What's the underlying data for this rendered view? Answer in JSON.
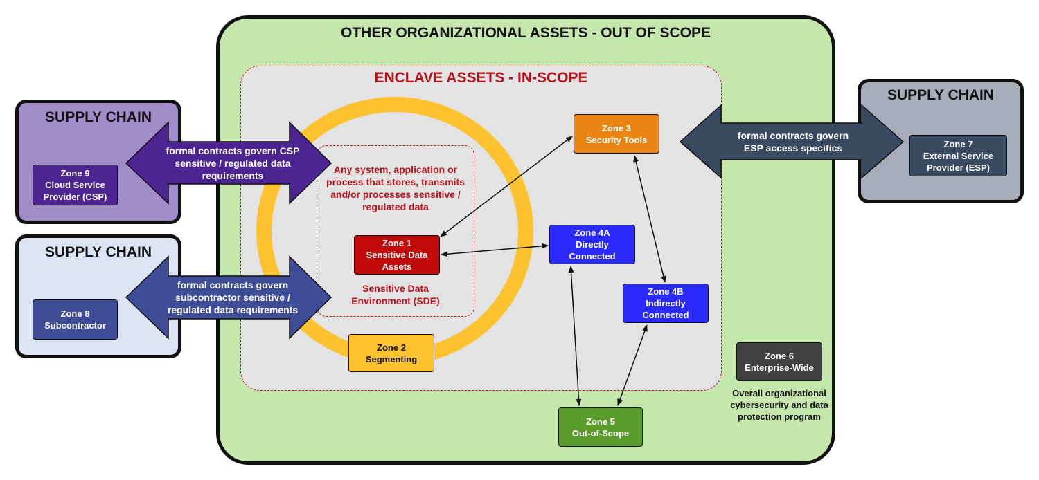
{
  "outer": {
    "title": "OTHER ORGANIZATIONAL ASSETS - OUT OF SCOPE"
  },
  "enclave": {
    "title": "ENCLAVE ASSETS - IN-SCOPE"
  },
  "sde": {
    "description_emphasis": "Any",
    "description_rest": " system, application or process that stores, transmits and/or processes sensitive / regulated data",
    "label_line1": "Sensitive Data",
    "label_line2": "Environment (SDE)"
  },
  "zones": {
    "zone1": [
      "Zone 1",
      "Sensitive Data",
      "Assets"
    ],
    "zone2": [
      "Zone 2",
      "Segmenting"
    ],
    "zone3": [
      "Zone 3",
      "Security Tools"
    ],
    "zone4a": [
      "Zone 4A",
      "Directly",
      "Connected"
    ],
    "zone4b": [
      "Zone 4B",
      "Indirectly",
      "Connected"
    ],
    "zone5": [
      "Zone 5",
      "Out-of-Scope"
    ],
    "zone6": [
      "Zone 6",
      "Enterprise-Wide"
    ],
    "zone7": [
      "Zone 7",
      "External Service",
      "Provider (ESP)"
    ],
    "zone8": [
      "Zone 8",
      "Subcontractor"
    ],
    "zone9": [
      "Zone 9",
      "Cloud Service",
      "Provider (CSP)"
    ]
  },
  "zone6_description": [
    "Overall organizational",
    "cybersecurity and data",
    "protection program"
  ],
  "supply_chain": {
    "csp": {
      "title": "SUPPLY CHAIN",
      "arrow_text": [
        "formal contracts govern CSP",
        "sensitive / regulated data",
        "requirements"
      ]
    },
    "subcontractor": {
      "title": "SUPPLY CHAIN",
      "arrow_text": [
        "formal contracts govern",
        "subcontractor sensitive /",
        "regulated data requirements"
      ]
    },
    "esp": {
      "title": "SUPPLY CHAIN",
      "arrow_text": [
        "formal contracts govern",
        "ESP access specifics"
      ]
    }
  },
  "colors": {
    "outer_bg": "#c5e6ac",
    "enclave_bg": "#e3e3e3",
    "scope_red": "#b5121b",
    "ring_yellow": "#fcc22f",
    "csp_arrow": "#4b2591",
    "sub_arrow": "#3f4c96",
    "esp_arrow": "#3a4a61"
  }
}
